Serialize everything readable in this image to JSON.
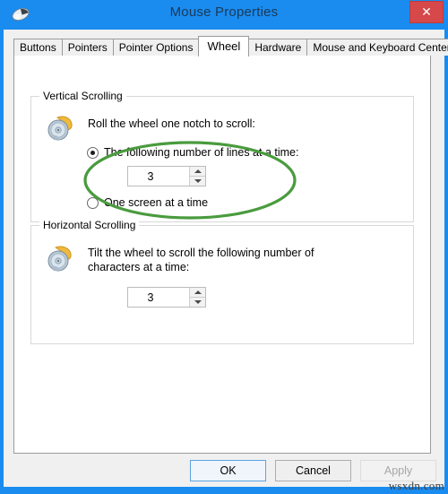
{
  "window": {
    "title": "Mouse Properties",
    "title_icon": "mouse-icon",
    "close_label": "✕",
    "titlebar_color": "#1a8cf0",
    "close_color": "#d6484a"
  },
  "tabs": [
    {
      "label": "Buttons",
      "active": false
    },
    {
      "label": "Pointers",
      "active": false
    },
    {
      "label": "Pointer Options",
      "active": false
    },
    {
      "label": "Wheel",
      "active": true
    },
    {
      "label": "Hardware",
      "active": false
    },
    {
      "label": "Mouse and Keyboard Center",
      "active": false
    }
  ],
  "vertical_scrolling": {
    "group_title": "Vertical Scrolling",
    "icon": "mouse-wheel-vertical-icon",
    "description": "Roll the wheel one notch to scroll:",
    "option_lines": {
      "label": "The following number of lines at a time:",
      "selected": true
    },
    "option_screen": {
      "label": "One screen at a time",
      "selected": false
    },
    "spinner_value": "3"
  },
  "horizontal_scrolling": {
    "group_title": "Horizontal Scrolling",
    "icon": "mouse-wheel-horizontal-icon",
    "description_line1": "Tilt the wheel to scroll the following number of",
    "description_line2": "characters at a time:",
    "spinner_value": "3"
  },
  "annotation": {
    "shape": "ellipse",
    "color": "#4a9b3e",
    "target": "the-following-number-of-lines-option"
  },
  "buttons": {
    "ok": "OK",
    "cancel": "Cancel",
    "apply": "Apply"
  },
  "watermark": "wsxdn.com"
}
